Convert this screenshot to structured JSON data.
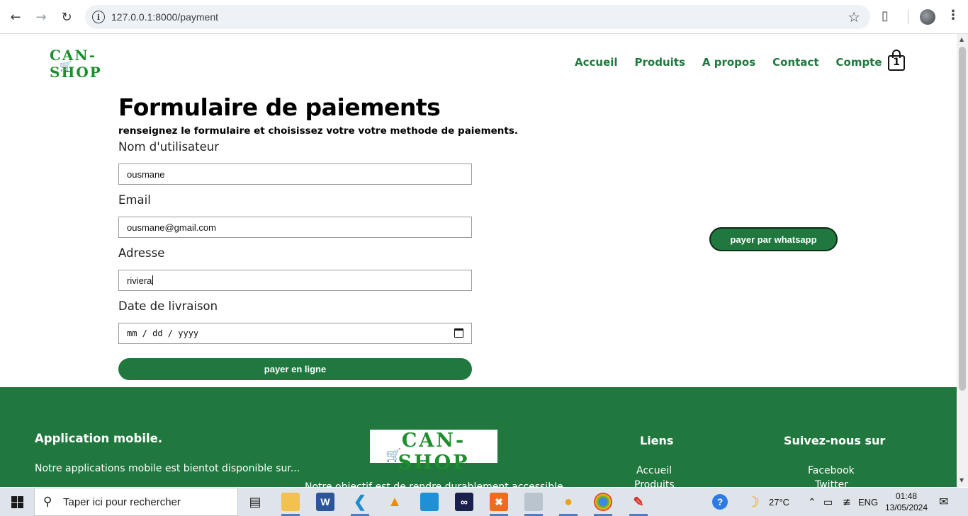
{
  "browser": {
    "url": "127.0.0.1:8000/payment"
  },
  "site": {
    "logo_text": "CAN-SHOP",
    "nav": [
      "Accueil",
      "Produits",
      "A propos",
      "Contact",
      "Compte"
    ],
    "cart_count": "1"
  },
  "form": {
    "title": "Formulaire de paiements",
    "subtitle": "renseignez le formulaire et choisissez votre votre methode de paiements.",
    "username_label": "Nom d'utilisateur",
    "username_value": "ousmane",
    "email_label": "Email",
    "email_value": "ousmane@gmail.com",
    "address_label": "Adresse",
    "address_value": "riviera",
    "date_label": "Date de livraison",
    "date_placeholder": "mm / dd / yyyy",
    "pay_online_label": "payer en ligne",
    "pay_whatsapp_label": "payer par whatsapp"
  },
  "footer": {
    "app_title": "Application mobile.",
    "app_text": "Notre applications mobile est bientot disponible sur...",
    "logo_text": "CAN-SHOP",
    "objective_text": "Notre objectif est de rendre durablement accessible",
    "links_title": "Liens",
    "links": [
      "Accueil",
      "Produits"
    ],
    "social_title": "Suivez-nous sur",
    "social": [
      "Facebook",
      "Twitter"
    ]
  },
  "taskbar": {
    "search_placeholder": "Taper ici pour rechercher",
    "temperature": "27°C",
    "language": "ENG",
    "time": "01:48",
    "date": "13/05/2024"
  },
  "colors": {
    "brand_green": "#21783f",
    "logo_green": "#1d8f2d",
    "cart_orange": "#e0a020"
  }
}
